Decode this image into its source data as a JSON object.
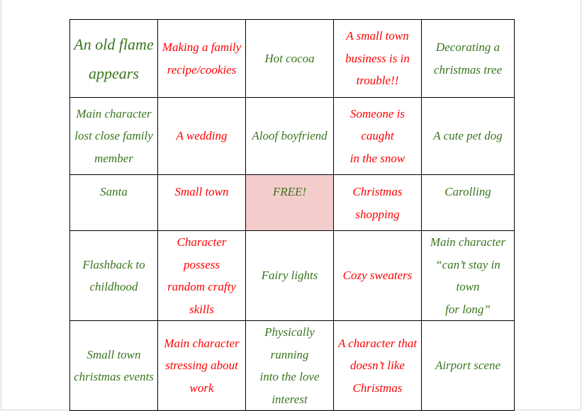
{
  "colors": {
    "green": "#38761d",
    "red": "#ff0000",
    "free_cell": "#f4cccc"
  },
  "bingo": {
    "rows": [
      [
        "An old flame\nappears",
        "Making a family\nrecipe/cookies",
        "Hot cocoa",
        "A small town\nbusiness is in\ntrouble!!",
        "Decorating a\nchristmas tree"
      ],
      [
        "Main character\nlost close family\nmember",
        "A wedding",
        "Aloof boyfriend",
        "Someone is caught\nin the snow",
        "A cute pet dog"
      ],
      [
        "Santa",
        "Small town",
        "FREE!",
        "Christmas\nshopping",
        "Carolling"
      ],
      [
        "Flashback to\nchildhood",
        "Character possess\nrandom crafty\nskills",
        "Fairy lights",
        "Cozy sweaters",
        "Main character\n“can’t stay in town\nfor long”"
      ],
      [
        "Small town\nchristmas events",
        "Main character\nstressing about\nwork",
        "Physically running\ninto the love\ninterest",
        "A character that\ndoesn’t like\nChristmas",
        "Airport scene"
      ]
    ]
  }
}
